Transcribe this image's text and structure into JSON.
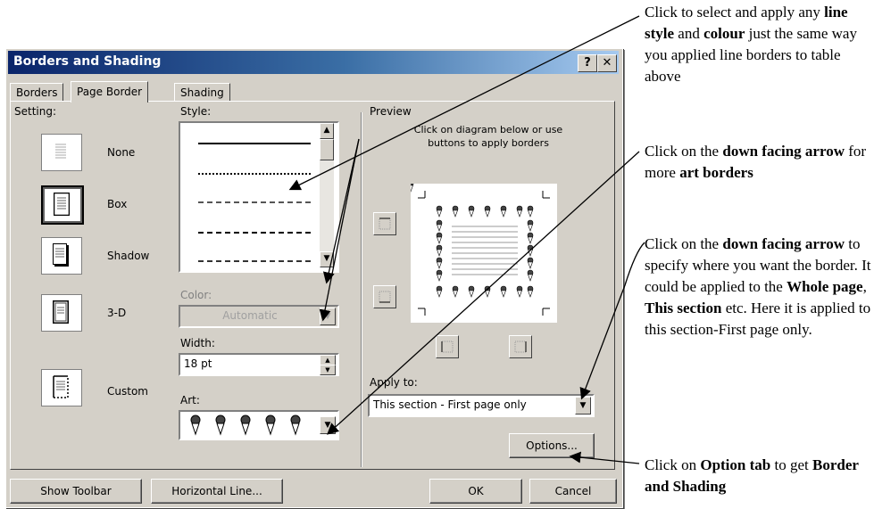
{
  "dialog": {
    "title": "Borders and Shading",
    "help_glyph": "?",
    "close_glyph": "✕",
    "tabs": [
      {
        "label": "Borders",
        "active": false
      },
      {
        "label": "Page Border",
        "active": true
      },
      {
        "label": "Shading",
        "active": false
      }
    ],
    "setting": {
      "label": "Setting:",
      "items": [
        {
          "label": "None",
          "selected": false
        },
        {
          "label": "Box",
          "selected": true
        },
        {
          "label": "Shadow",
          "selected": false
        },
        {
          "label": "3-D",
          "selected": false
        },
        {
          "label": "Custom",
          "selected": false
        }
      ]
    },
    "style": {
      "label": "Style:"
    },
    "color": {
      "label": "Color:",
      "value": "Automatic"
    },
    "width": {
      "label": "Width:",
      "value": "18 pt"
    },
    "art": {
      "label": "Art:"
    },
    "preview": {
      "label": "Preview",
      "hint_line1": "Click on diagram below or use",
      "hint_line2": "buttons to apply borders"
    },
    "apply_to": {
      "label": "Apply to:",
      "value": "This section - First page only"
    },
    "buttons": {
      "options": "Options...",
      "show_toolbar": "Show Toolbar",
      "horizontal_line": "Horizontal Line...",
      "ok": "OK",
      "cancel": "Cancel"
    }
  },
  "annotations": [
    {
      "parts": [
        "Click to select and apply any ",
        "line style",
        " and ",
        "colour",
        " just the same way you applied line borders to table above"
      ]
    },
    {
      "parts": [
        "Click on the ",
        "down facing arrow",
        " for more ",
        "art borders",
        ""
      ]
    },
    {
      "parts": [
        "Click on the ",
        "down facing arrow",
        " to specify where you want the border. It could be applied to the ",
        "Whole page",
        ", ",
        "This section",
        " etc. Here it is applied to this section-First page only."
      ]
    },
    {
      "parts": [
        "Click on ",
        "Option tab",
        " to get ",
        "Border and Shading",
        ""
      ]
    }
  ],
  "colors": {
    "titlebar_start": "#0a246a",
    "titlebar_end": "#a6caf0",
    "dialog_face": "#d4d0c8"
  }
}
